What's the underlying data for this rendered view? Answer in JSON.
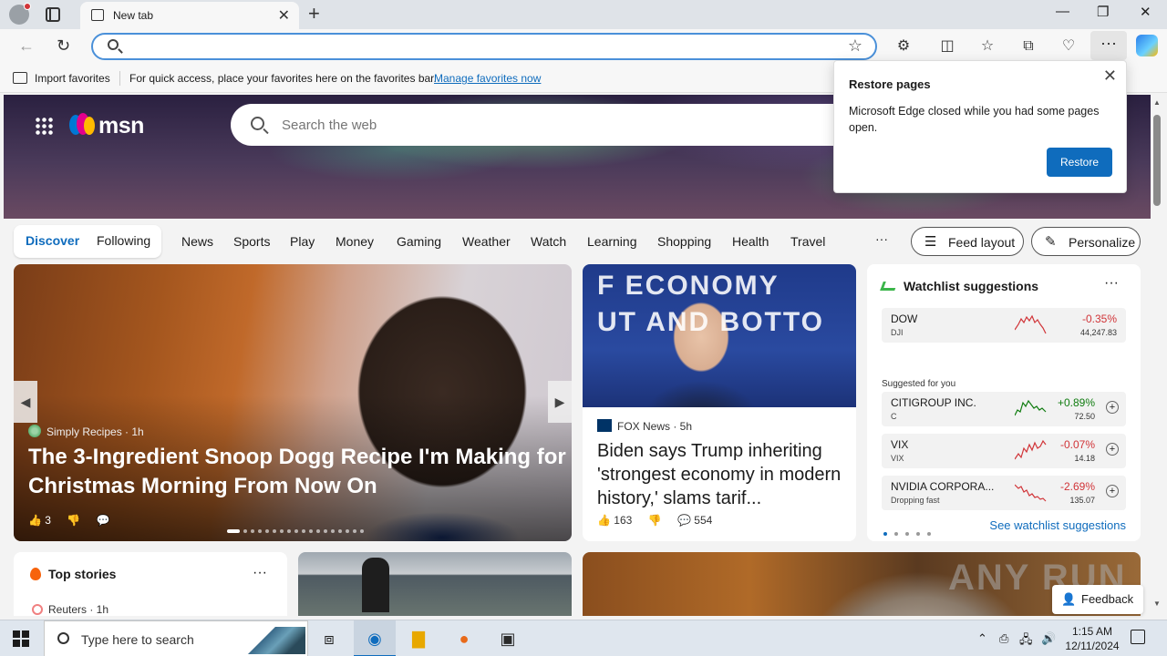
{
  "browser": {
    "tab_title": "New tab",
    "omnibox_value": "",
    "omnibox_placeholder": "",
    "favorites_bar": {
      "import_label": "Import favorites",
      "message": "For quick access, place your favorites here on the favorites bar.",
      "manage_link": "Manage favorites now"
    }
  },
  "restore_popup": {
    "title": "Restore pages",
    "message": "Microsoft Edge closed while you had some pages open.",
    "button": "Restore"
  },
  "msn": {
    "logo_text": "msn",
    "search_placeholder": "Search the web",
    "segments": [
      "Discover",
      "Following"
    ],
    "nav": [
      "News",
      "Sports",
      "Play",
      "Money",
      "Gaming",
      "Weather",
      "Watch",
      "Learning",
      "Shopping",
      "Health",
      "Travel"
    ],
    "more": "···",
    "feed_layout": "Feed layout",
    "personalize": "Personalize"
  },
  "lead_card": {
    "source": "Simply Recipes · 1h",
    "title": "The 3-Ingredient Snoop Dogg Recipe I'm Making for Christmas Morning From Now On",
    "likes": "3"
  },
  "news_card": {
    "image_text": "F ECONOMY\nUT AND BOTTO",
    "source": "FOX News · 5h",
    "title": "Biden says Trump inheriting 'strongest economy in modern history,' slams tarif...",
    "likes": "163",
    "comments": "554"
  },
  "watchlist": {
    "title": "Watchlist suggestions",
    "more": "···",
    "suggested_label": "Suggested for you",
    "see_more": "See watchlist suggestions",
    "stocks": [
      {
        "name": "DOW",
        "symbol": "DJI",
        "change": "-0.35%",
        "price": "44,247.83",
        "trend": "neg"
      },
      {
        "name": "CITIGROUP INC.",
        "symbol": "C",
        "change": "+0.89%",
        "price": "72.50",
        "trend": "pos"
      },
      {
        "name": "VIX",
        "symbol": "VIX",
        "change": "-0.07%",
        "price": "14.18",
        "trend": "neg"
      },
      {
        "name": "NVIDIA CORPORA...",
        "symbol": "Dropping fast",
        "change": "-2.69%",
        "price": "135.07",
        "trend": "neg"
      }
    ]
  },
  "top_stories": {
    "title": "Top stories",
    "more": "···",
    "source": "Reuters · 1h"
  },
  "feedback": "Feedback",
  "watermark": "ANY RUN",
  "taskbar": {
    "search_placeholder": "Type here to search",
    "time": "1:15 AM",
    "date": "12/11/2024"
  },
  "colors": {
    "accent": "#0f6cbd",
    "negative": "#d13438",
    "positive": "#107c10"
  }
}
